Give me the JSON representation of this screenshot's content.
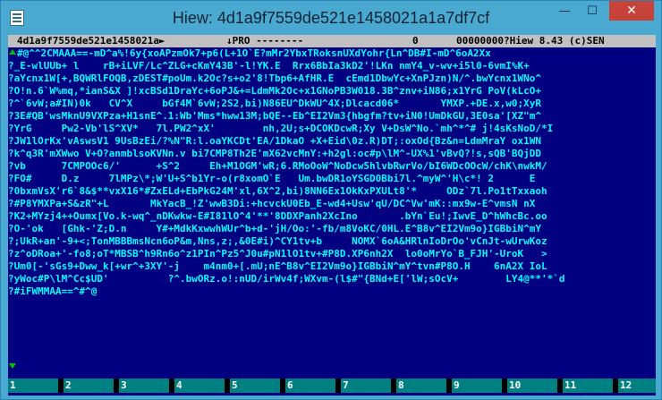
{
  "window": {
    "title": "Hiew: 4d1a9f7559de521e1458021a1a7df7cf",
    "minimize_glyph": "—",
    "maximize_glyph": "☐",
    "close_glyph": "✕"
  },
  "statusbar": {
    "filename": "4d1a9f7559de521e1458021a►",
    "mode": "↓PRO --------",
    "column": "0",
    "offset": "00000000?Hiew 8.43 (c)SEN"
  },
  "lines": [
    "#@^^2CMAAA==-mD^a%!6y{xoAPzmOk7+p6(L+1O`E?mMr2YbxTRoksnUXdYohr{Ln^DB#I-mD^6oA2Xx",
    "_E-wlUUb+ l    rB+iLVF/Lc^ZLG+cKmY43B'-l!YK.E  Rrx6BbIa3kD2'!LKn nmY4_v-wv+i5l0-6vmI%K+",
    "aYcnx1W[+,BQWRlFOQB,zDEST#poUm.k2Oc?s+o2'8!Tbp6+AfHR.E  cEmd1DbwYc+XnPJzn)N/^.bwYcnx1WNo^",
    "O!n.6`W%mq,*ianS&X ]!xcBSd1DraYc+6oPJ&+=LdmMk2Oc+x1GNoPB3W018.3B^znv+iN86;x1YrG PoV(kLcO+",
    "^`6vW;a#IN)0k   CV^X     bGf4M`6vW;2S2,bi)N86EU^DkWU^4X;Dlcacd06*       YMXP.+DE.x,w0;XyR",
    "3E#QB'wsMknU9VXPza+H1snE^.1:Wb'Mms*hww13M;bQE--Eb^EI2Vm3{hbgfm?tv+iN0!UmDkGU,3E0sa'[XZ\"m^",
    "YrG     Pw2-Vb'lS^XV*   7l.PW2^xX'        nh,2U;s+DCOKDcwR;Xy V+DsW^No.`mh^*^# j!4sKsNoD/*I",
    "JW1lOrKx'vAswsV1 9UsBzEi/?%N\"R:l.oaYKCDt'EA/1DkaO +X+Eid\\0z.R)DT;:oxOd{Bz&n=LdmMraY ox1WN",
    "k^q3R'mXWwo V+O?anmblsoKVNn.v bi7CMP8Th2E'mX62vcMnY:+h2gl:oc#p\\lM^-UX%1'vBvQ?!s,sQB'BQjDD",
    "vb      7CMPOOc6/'      +S^2     Eh+M1OGM'wR;6.RMoOoW^NoDcw5hlvbRwrVo/bI6WDcOOcW/chK\\nwkM/",
    "FO#     D.z     7lMPz\\*;W'U+S^b1Yr-o(r8xomO`E   Um.bwDR1oYSGD0Bbi7l.^myW^'H\\c*! 2      E",
    "0bxmVsX'r6`8&$**vxX16*#ZxELd+EbPkG24M'xl,6X^2,bi)8NN6Ex1OkKxPXULt8'*     ODz`7l.Po1tTxxaoh",
    "#P8YMXPa+S&zR\"+L       MkYacB_!Z'wwB3Di:+hcvckU0Eb_E-wd4+Usw'qU/DC^Vw'mK::mx9w-E^vmsN nX",
    "K2+MYzj4++Oumx[Vo.k-wq^_nDKwkw-E#I81lO^4'**'8DDXPanh2XcIno       .bYn`Eu!;IwvE_D^hWhcBc.oo",
    "O-'ok   [Ghk-'Z;D.n     Y#+MdkKxwwhWUr^b+d-'jH/Oo:'-fb/m8VoKC/0HL.E^B8v^EI2Vm9o}IGBbiN^mY",
    ";UkR+an'-9+<;TonMBBBmsNcn6oP&m,Nns,z;,&0E#i)^CY1tv+b     NOMX`6oA&HRlnIoDrOo'vCnJt-wUrwKoz",
    "z^oDRoa+'-fo8;oT*MBSB^h9Rn6o^z1PIn^Pz5^J0u#pN1lO1tv+#P8D.XP6nh2X  lo0oMrYo`B_FJH'-UroK   >",
    "Um0[-'sGs9+Dww_k[+wr^+3XY'-j    m4nm0+[.mU;nE^B8v^EI2Vm9o}IGBbiN^mY^tvn#P8O.H    6nA2X IoL",
    "yWoc#P\\lM^Cc$UD'          ?^.bwORz.o!:nUD/irWv4f;WXvm-(l$#\"{BNd+E['lW;sOcV+        LY4@**'*`d",
    "#iFWMMAA==^#^@"
  ],
  "scrollbar": {
    "up_glyph": "↑",
    "down_glyph": "↓"
  },
  "fkeys": [
    "1",
    "2",
    "3",
    "4",
    "5",
    "6",
    "7",
    "8",
    "9",
    "10",
    "11",
    "12"
  ]
}
